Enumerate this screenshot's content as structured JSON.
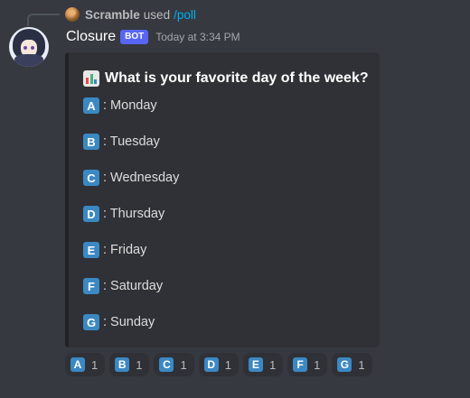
{
  "reply": {
    "user": "Scramble",
    "used": "used",
    "command": "/poll"
  },
  "message": {
    "username": "Closure",
    "bot_tag": "BOT",
    "timestamp": "Today at 3:34 PM"
  },
  "poll": {
    "icon": "bar-chart-icon",
    "title": "What is your favorite day of the week?",
    "options": [
      {
        "letter": "A",
        "label": ": Monday"
      },
      {
        "letter": "B",
        "label": ": Tuesday"
      },
      {
        "letter": "C",
        "label": ": Wednesday"
      },
      {
        "letter": "D",
        "label": ": Thursday"
      },
      {
        "letter": "E",
        "label": ": Friday"
      },
      {
        "letter": "F",
        "label": ": Saturday"
      },
      {
        "letter": "G",
        "label": ": Sunday"
      }
    ]
  },
  "reactions": [
    {
      "letter": "A",
      "count": "1"
    },
    {
      "letter": "B",
      "count": "1"
    },
    {
      "letter": "C",
      "count": "1"
    },
    {
      "letter": "D",
      "count": "1"
    },
    {
      "letter": "E",
      "count": "1"
    },
    {
      "letter": "F",
      "count": "1"
    },
    {
      "letter": "G",
      "count": "1"
    }
  ],
  "colors": {
    "background": "#36393f",
    "embed": "#2f3136",
    "letter_box": "#3b88c3",
    "bot_tag": "#5865f2",
    "command": "#00aff4"
  }
}
